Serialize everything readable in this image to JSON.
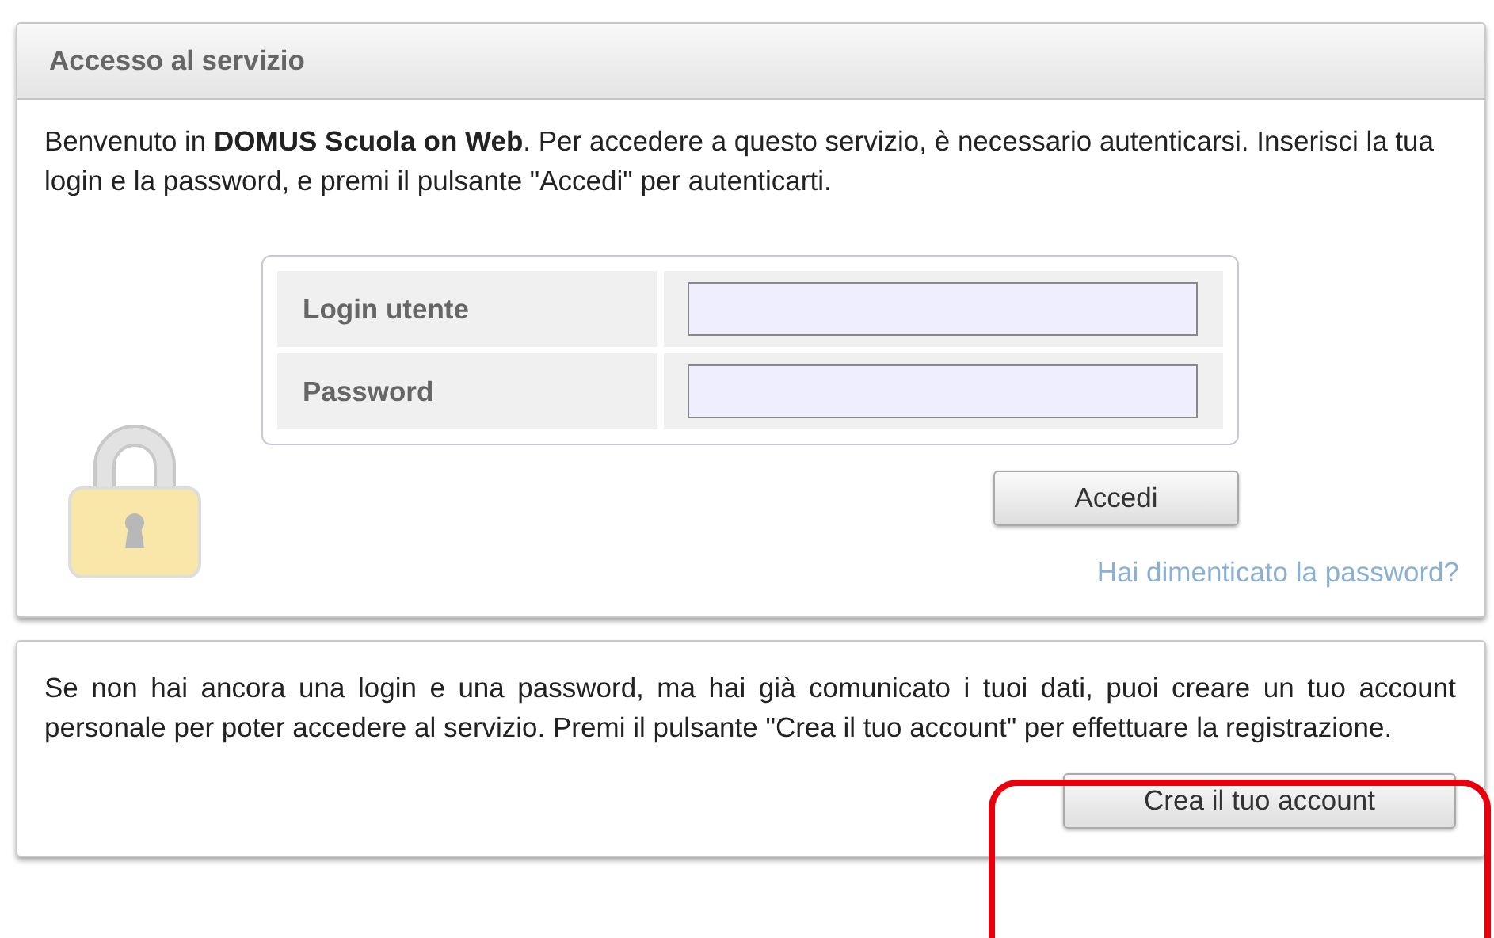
{
  "login_panel": {
    "title": "Accesso al servizio",
    "intro": "Benvenuto in **DOMUS Scuola on Web**. Per accedere a questo servizio, è necessario autenticarsi. Inserisci la tua login e la password, e premi il pulsante \"Accedi\" per autenticarti.",
    "fields": [
      {
        "label": "Login utente"
      },
      {
        "label": "Password"
      }
    ],
    "submit_button": "Accedi",
    "forgot_link": "Hai dimenticato la password?"
  },
  "register_panel": {
    "text": "Se non hai ancora una login e una password, ma hai già comunicato i tuoi dati, puoi creare un tuo account personale per poter accedere al servizio. Premi il pulsante \"Crea il tuo account\" per effettuare la registrazione.",
    "button": "Crea il tuo account",
    "highlight": {
      "kind": "frame"
    }
  }
}
